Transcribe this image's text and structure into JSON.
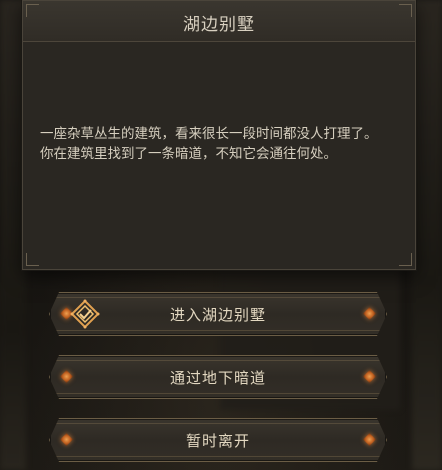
{
  "dialog": {
    "title": "湖边别墅",
    "body_lines": [
      "一座杂草丛生的建筑，看来很长一段时间都没人打理了。",
      "你在建筑里找到了一条暗道，不知它会通往何处。"
    ]
  },
  "options": [
    {
      "label": "进入湖边别墅",
      "icon": "quest-marker-icon"
    },
    {
      "label": "通过地下暗道"
    },
    {
      "label": "暂时离开"
    }
  ],
  "colors": {
    "panel_bg": "#2a2722",
    "title_bar": "#34302a",
    "text": "#d6cfbf",
    "button_border": "#6b5d45",
    "gem": "#e08a3a"
  }
}
